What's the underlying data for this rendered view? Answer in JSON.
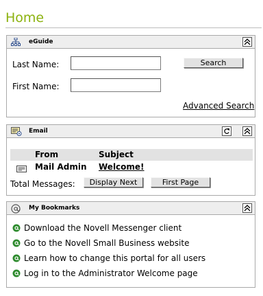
{
  "page": {
    "title": "Home"
  },
  "eguide": {
    "title": "eGuide",
    "last_name_label": "Last Name:",
    "last_name_value": "",
    "first_name_label": "First Name:",
    "first_name_value": "",
    "search_label": "Search",
    "advanced_search_label": "Advanced Search",
    "collapse_icon": "collapse-up-icon"
  },
  "email": {
    "title": "Email",
    "columns": {
      "from": "From",
      "subject": "Subject"
    },
    "rows": [
      {
        "from": "Mail Admin",
        "subject": "Welcome!"
      }
    ],
    "total_label": "Total Messages:",
    "display_next_label": "Display Next",
    "first_page_label": "First Page",
    "refresh_icon": "refresh-icon",
    "collapse_icon": "collapse-up-icon"
  },
  "bookmarks": {
    "title": "My Bookmarks",
    "items": [
      "Download the Novell Messenger client",
      "Go to the Novell Small Business website",
      "Learn how to change this portal for all users",
      "Log in to the Administrator Welcome page"
    ],
    "collapse_icon": "collapse-up-icon"
  },
  "colors": {
    "title_green": "#8cb20f",
    "header_bg": "#eeeeee",
    "border": "#a9a9a9"
  }
}
